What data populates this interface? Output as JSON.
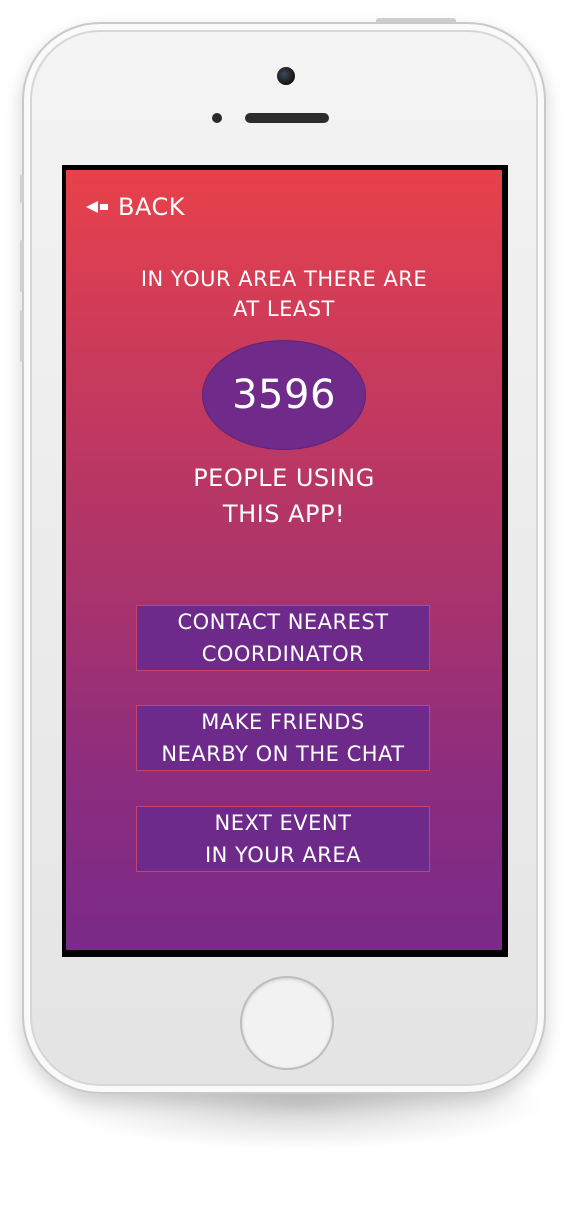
{
  "screen": {
    "back_label": "BACK",
    "intro_line1": "IN YOUR AREA THERE ARE",
    "intro_line2": "AT LEAST",
    "count": "3596",
    "people_line1": "PEOPLE USING",
    "people_line2": "THIS APP!"
  },
  "actions": [
    {
      "line1": "CONTACT NEAREST",
      "line2": "COORDINATOR"
    },
    {
      "line1": "MAKE FRIENDS",
      "line2": "NEARBY ON THE CHAT"
    },
    {
      "line1": "NEXT EVENT",
      "line2": "IN YOUR AREA"
    }
  ],
  "colors": {
    "gradient_top": "#e8414a",
    "gradient_bottom": "#7a2a88",
    "button_fill": "#6e2a8a",
    "button_border": "#c8426a",
    "oval_fill": "#6f2a8a"
  },
  "icons": {
    "back": "back-arrow-icon"
  }
}
